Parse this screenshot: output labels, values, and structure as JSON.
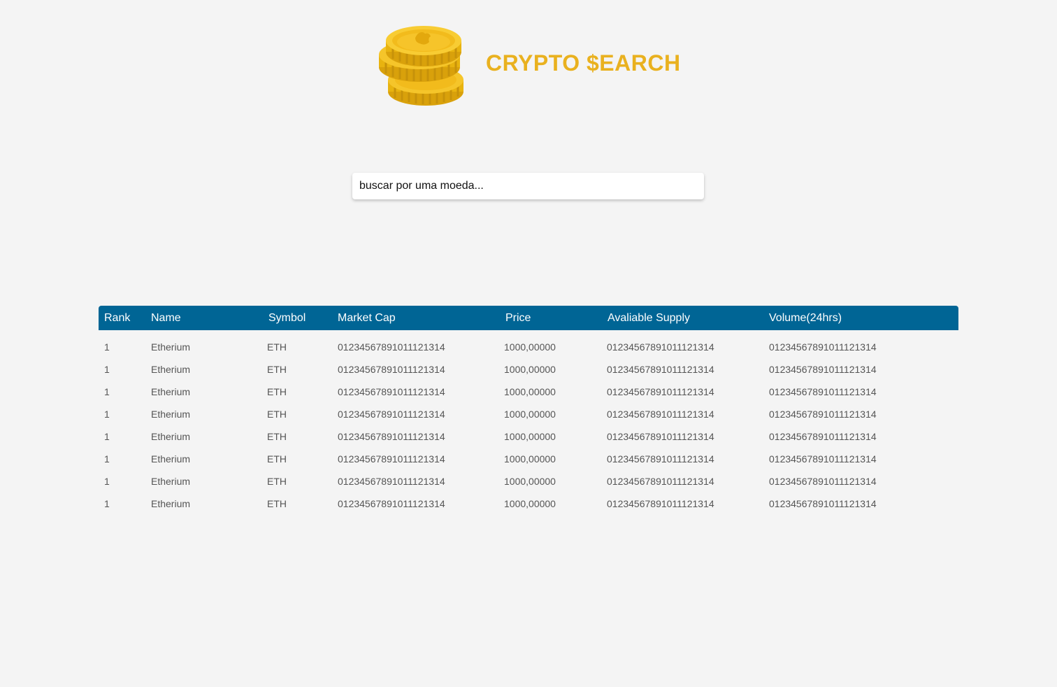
{
  "brand": {
    "title": "CRYPTO $EARCH",
    "logo_icon": "coin-stack-icon",
    "title_color": "#e9b11f"
  },
  "search": {
    "placeholder": "buscar por uma moeda..."
  },
  "table": {
    "header_color": "#006595",
    "columns": [
      "Rank",
      "Name",
      "Symbol",
      "Market Cap",
      "Price",
      "Avaliable Supply",
      "Volume(24hrs)"
    ],
    "rows": [
      [
        "1",
        "Etherium",
        "ETH",
        "01234567891011121314",
        "1000,00000",
        "01234567891011121314",
        "01234567891011121314"
      ],
      [
        "1",
        "Etherium",
        "ETH",
        "01234567891011121314",
        "1000,00000",
        "01234567891011121314",
        "01234567891011121314"
      ],
      [
        "1",
        "Etherium",
        "ETH",
        "01234567891011121314",
        "1000,00000",
        "01234567891011121314",
        "01234567891011121314"
      ],
      [
        "1",
        "Etherium",
        "ETH",
        "01234567891011121314",
        "1000,00000",
        "01234567891011121314",
        "01234567891011121314"
      ],
      [
        "1",
        "Etherium",
        "ETH",
        "01234567891011121314",
        "1000,00000",
        "01234567891011121314",
        "01234567891011121314"
      ],
      [
        "1",
        "Etherium",
        "ETH",
        "01234567891011121314",
        "1000,00000",
        "01234567891011121314",
        "01234567891011121314"
      ],
      [
        "1",
        "Etherium",
        "ETH",
        "01234567891011121314",
        "1000,00000",
        "01234567891011121314",
        "01234567891011121314"
      ],
      [
        "1",
        "Etherium",
        "ETH",
        "01234567891011121314",
        "1000,00000",
        "01234567891011121314",
        "01234567891011121314"
      ]
    ]
  }
}
